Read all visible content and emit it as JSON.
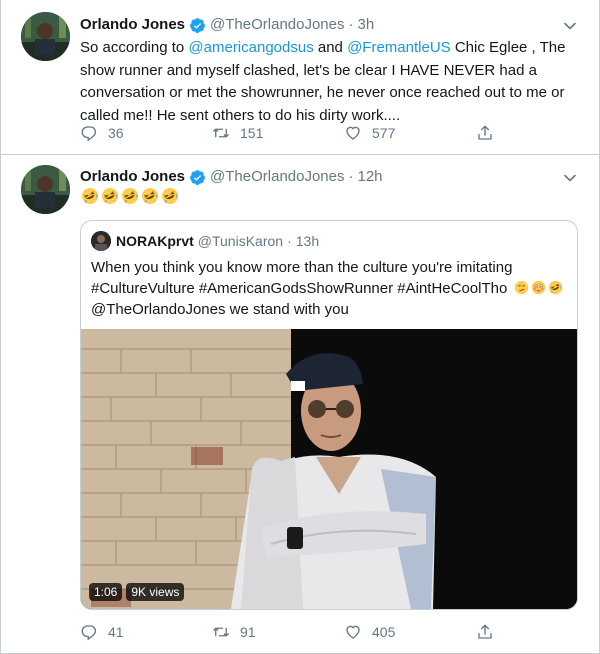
{
  "colors": {
    "link": "#1b95e0",
    "muted": "#657786",
    "verified": "#1da1f2",
    "text": "#14171a"
  },
  "tweets": [
    {
      "author_name": "Orlando Jones",
      "handle": "@TheOrlandoJones",
      "separator": "·",
      "time": "3h",
      "text_part1": "So according to ",
      "mention1": "@americangodsus",
      "text_part2": " and ",
      "mention2": "@FremantleUS",
      "text_part3": "  Chic Eglee , The show runner and myself clashed, let's be clear I HAVE NEVER had a conversation or met the showrunner, he never once reached out to me or called me!! He sent others to do his dirty work....",
      "replies": "36",
      "retweets": "151",
      "likes": "577",
      "icons": [
        "reply-icon",
        "retweet-icon",
        "like-icon",
        "share-icon",
        "verified-icon",
        "chevron-down-icon"
      ]
    },
    {
      "author_name": "Orlando Jones",
      "handle": "@TheOrlandoJones",
      "separator": "·",
      "time": "12h",
      "emojis": [
        "rofl",
        "rofl",
        "rofl",
        "rofl",
        "rofl"
      ],
      "replies": "41",
      "retweets": "91",
      "likes": "405",
      "quote": {
        "author_name": "NORAKprvt",
        "handle": "@TunisKaron",
        "separator": "·",
        "time": "13h",
        "line1": "When you think you know more than the culture you're imitating",
        "line2": "#CultureVulture #AmericanGodsShowRunner #AintHeCoolTho",
        "line2_emojis": [
          "smirk",
          "flushed",
          "rofl"
        ],
        "line3": "@TheOrlandoJones we stand with you",
        "video_duration": "1:06",
        "video_views": "9K views"
      }
    }
  ]
}
